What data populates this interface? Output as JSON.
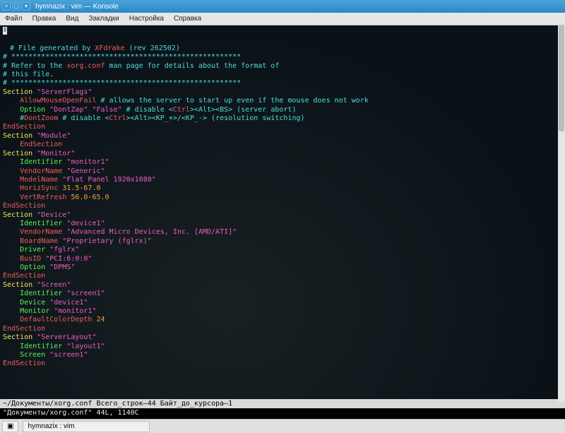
{
  "window": {
    "title": "hymnazix : vim — Konsole"
  },
  "menu": [
    "Файл",
    "Правка",
    "Вид",
    "Закладки",
    "Настройка",
    "Справка"
  ],
  "lines": [
    [
      [
        "c-cyan",
        "# File generated by "
      ],
      [
        "c-red",
        "XFdrake"
      ],
      [
        "c-cyan",
        " (rev 262502)"
      ]
    ],
    [
      [
        "c-white",
        ""
      ]
    ],
    [
      [
        "c-cyan",
        "# ******************************************************"
      ]
    ],
    [
      [
        "c-cyan",
        "# Refer to the "
      ],
      [
        "c-red",
        "xorg.conf"
      ],
      [
        "c-cyan",
        " man page for details about the format of"
      ]
    ],
    [
      [
        "c-cyan",
        "# this file."
      ]
    ],
    [
      [
        "c-cyan",
        "# ******************************************************"
      ]
    ],
    [
      [
        "c-white",
        ""
      ]
    ],
    [
      [
        "c-yellow",
        "Section "
      ],
      [
        "c-magenta",
        "\"ServerFlags\""
      ]
    ],
    [
      [
        "c-white",
        "    "
      ],
      [
        "c-red",
        "AllowMouseOpenFail"
      ],
      [
        "c-cyan",
        " # allows the server to start up even if the mouse does not work"
      ]
    ],
    [
      [
        "c-white",
        "    "
      ],
      [
        "c-green",
        "Option "
      ],
      [
        "c-magenta",
        "\"DontZap\" \"False\""
      ],
      [
        "c-cyan",
        " # disable <"
      ],
      [
        "c-red",
        "Ctrl"
      ],
      [
        "c-cyan",
        "><Alt><BS> (server abort)"
      ]
    ],
    [
      [
        "c-white",
        "    "
      ],
      [
        "c-cyan",
        "#"
      ],
      [
        "c-red",
        "DontZoom"
      ],
      [
        "c-cyan",
        " # disable <"
      ],
      [
        "c-red",
        "Ctrl"
      ],
      [
        "c-cyan",
        "><Alt><KP_+>/<KP_-> (resolution switching)"
      ]
    ],
    [
      [
        "c-red",
        "EndSection"
      ]
    ],
    [
      [
        "c-white",
        ""
      ]
    ],
    [
      [
        "c-yellow",
        "Section "
      ],
      [
        "c-magenta",
        "\"Module\""
      ]
    ],
    [
      [
        "c-white",
        "    "
      ],
      [
        "c-red",
        "EndSection"
      ]
    ],
    [
      [
        "c-white",
        ""
      ]
    ],
    [
      [
        "c-yellow",
        "Section "
      ],
      [
        "c-magenta",
        "\"Monitor\""
      ]
    ],
    [
      [
        "c-white",
        "    "
      ],
      [
        "c-green",
        "Identifier "
      ],
      [
        "c-magenta",
        "\"monitor1\""
      ]
    ],
    [
      [
        "c-white",
        "    "
      ],
      [
        "c-red",
        "VendorName "
      ],
      [
        "c-magenta",
        "\"Generic\""
      ]
    ],
    [
      [
        "c-white",
        "    "
      ],
      [
        "c-red",
        "ModelName "
      ],
      [
        "c-magenta",
        "\"Flat Panel 1920x1080\""
      ]
    ],
    [
      [
        "c-white",
        "    "
      ],
      [
        "c-red",
        "HorizSync "
      ],
      [
        "c-orange",
        "31.5-67.0"
      ]
    ],
    [
      [
        "c-white",
        "    "
      ],
      [
        "c-red",
        "VertRefresh "
      ],
      [
        "c-orange",
        "56.0-65.0"
      ]
    ],
    [
      [
        "c-red",
        "EndSection"
      ]
    ],
    [
      [
        "c-white",
        ""
      ]
    ],
    [
      [
        "c-yellow",
        "Section "
      ],
      [
        "c-magenta",
        "\"Device\""
      ]
    ],
    [
      [
        "c-white",
        "    "
      ],
      [
        "c-green",
        "Identifier "
      ],
      [
        "c-magenta",
        "\"device1\""
      ]
    ],
    [
      [
        "c-white",
        "    "
      ],
      [
        "c-red",
        "VendorName "
      ],
      [
        "c-magenta",
        "\"Advanced Micro Devices, Inc. [AMD/ATI]\""
      ]
    ],
    [
      [
        "c-white",
        "    "
      ],
      [
        "c-red",
        "BoardName "
      ],
      [
        "c-magenta",
        "\"Proprietary (fglrx)\""
      ]
    ],
    [
      [
        "c-white",
        "    "
      ],
      [
        "c-green",
        "Driver "
      ],
      [
        "c-magenta",
        "\"fglrx\""
      ]
    ],
    [
      [
        "c-white",
        "    "
      ],
      [
        "c-red",
        "BusID "
      ],
      [
        "c-magenta",
        "\"PCI:6:0:0\""
      ]
    ],
    [
      [
        "c-white",
        "    "
      ],
      [
        "c-green",
        "Option "
      ],
      [
        "c-magenta",
        "\"DPMS\""
      ]
    ],
    [
      [
        "c-red",
        "EndSection"
      ]
    ],
    [
      [
        "c-white",
        ""
      ]
    ],
    [
      [
        "c-yellow",
        "Section "
      ],
      [
        "c-magenta",
        "\"Screen\""
      ]
    ],
    [
      [
        "c-white",
        "    "
      ],
      [
        "c-green",
        "Identifier "
      ],
      [
        "c-magenta",
        "\"screen1\""
      ]
    ],
    [
      [
        "c-white",
        "    "
      ],
      [
        "c-green",
        "Device "
      ],
      [
        "c-magenta",
        "\"device1\""
      ]
    ],
    [
      [
        "c-white",
        "    "
      ],
      [
        "c-green",
        "Monitor "
      ],
      [
        "c-magenta",
        "\"monitor1\""
      ]
    ],
    [
      [
        "c-white",
        "    "
      ],
      [
        "c-red",
        "DefaultColorDepth "
      ],
      [
        "c-orange",
        "24"
      ]
    ],
    [
      [
        "c-red",
        "EndSection"
      ]
    ],
    [
      [
        "c-white",
        ""
      ]
    ],
    [
      [
        "c-yellow",
        "Section "
      ],
      [
        "c-magenta",
        "\"ServerLayout\""
      ]
    ],
    [
      [
        "c-white",
        "    "
      ],
      [
        "c-green",
        "Identifier "
      ],
      [
        "c-magenta",
        "\"layout1\""
      ]
    ],
    [
      [
        "c-white",
        "    "
      ],
      [
        "c-green",
        "Screen "
      ],
      [
        "c-magenta",
        "\"screen1\""
      ]
    ],
    [
      [
        "c-red",
        "EndSection"
      ]
    ]
  ],
  "ruler_glyph": "⦀",
  "status1": "~/Документы/xorg.conf Всего_строк—44 Байт_до_курсора—1",
  "status2": "\"Документы/xorg.conf\" 44L, 1140C",
  "taskbar": {
    "btn_glyph": "▣",
    "tab_label": "hymnazix : vim"
  }
}
